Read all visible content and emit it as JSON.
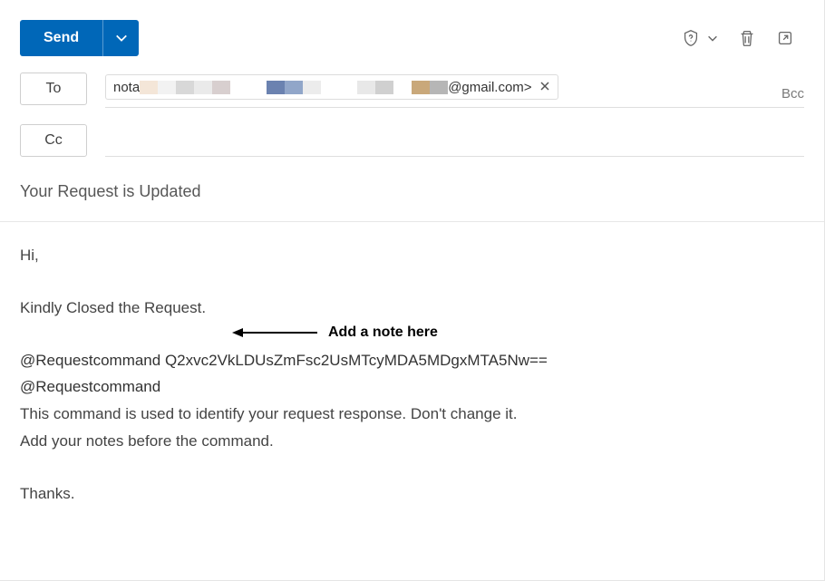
{
  "toolbar": {
    "send_label": "Send"
  },
  "fields": {
    "to_label": "To",
    "cc_label": "Cc",
    "bcc_label": "Bcc"
  },
  "recipient": {
    "prefix": "nota",
    "suffix": "@gmail.com>"
  },
  "subject": "Your Request is Updated",
  "body": {
    "greeting": "Hi,",
    "line1": "Kindly Closed the Request.",
    "cmd1": "@Requestcommand Q2xvc2VkLDUsZmFsc2UsMTcyMDA5MDgxMTA5Nw==",
    "cmd2": "@Requestcommand",
    "info1": "This command is used to identify your request response. Don't change it.",
    "info2": "Add your notes before the command.",
    "signoff": "Thanks."
  },
  "annotation": {
    "text": "Add a note here"
  }
}
